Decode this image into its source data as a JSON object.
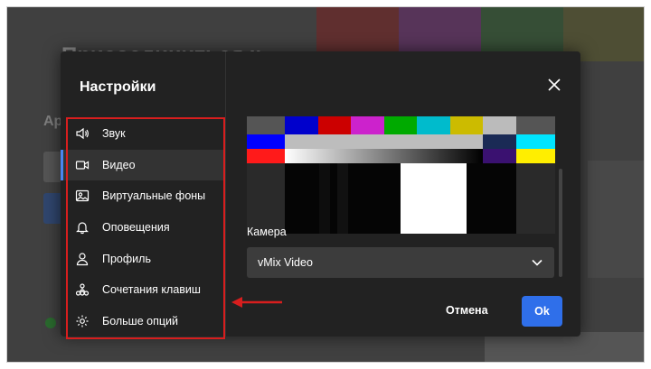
{
  "background": {
    "title": "Присоединиться к",
    "label": "Ар",
    "bar_colors": [
      "#7a2020",
      "#6a2a6e",
      "#2d5a2d",
      "#5a5a2a"
    ]
  },
  "dialog": {
    "title": "Настройки",
    "menu": [
      {
        "label": "Звук",
        "icon": "speaker-icon",
        "active": false
      },
      {
        "label": "Видео",
        "icon": "video-camera-icon",
        "active": true
      },
      {
        "label": "Виртуальные фоны",
        "icon": "image-icon",
        "active": false
      },
      {
        "label": "Оповещения",
        "icon": "bell-icon",
        "active": false
      },
      {
        "label": "Профиль",
        "icon": "user-icon",
        "active": false
      },
      {
        "label": "Сочетания клавиш",
        "icon": "keyboard-shortcuts-icon",
        "active": false
      },
      {
        "label": "Больше опций",
        "icon": "gear-icon",
        "active": false
      }
    ],
    "camera_label": "Камера",
    "camera_value": "vMix Video",
    "cancel_label": "Отмена",
    "ok_label": "Ok"
  },
  "colors": {
    "accent": "#2f6fea",
    "highlight_box": "#d81e1e"
  }
}
